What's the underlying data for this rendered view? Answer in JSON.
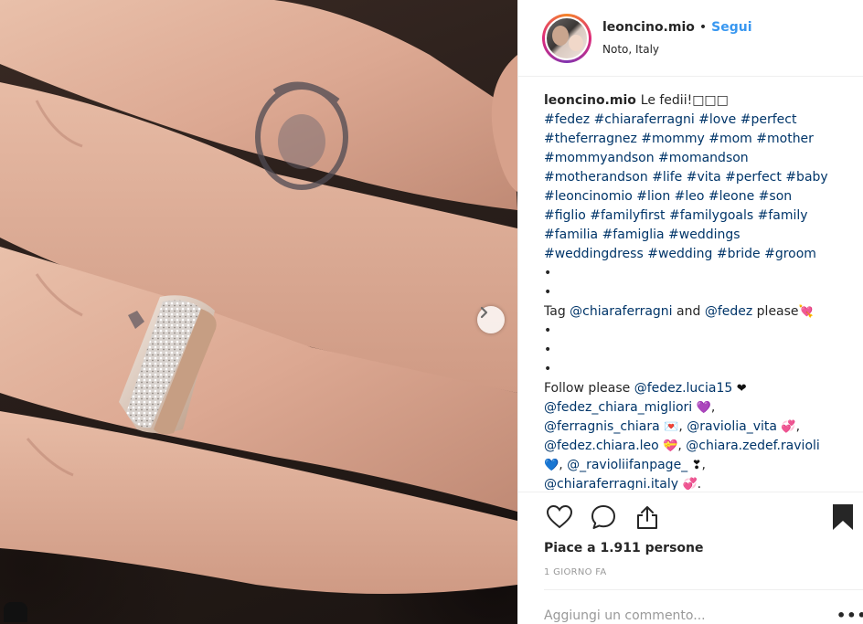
{
  "header": {
    "username": "leoncino.mio",
    "separator": "•",
    "follow_label": "Segui",
    "location": "Noto, Italy"
  },
  "caption": {
    "username": "leoncino.mio",
    "lines": [
      [
        {
          "t": "text",
          "v": "Le fedii!□□□"
        }
      ],
      [
        {
          "t": "tag",
          "v": "#fedez"
        },
        {
          "t": "text",
          "v": " "
        },
        {
          "t": "tag",
          "v": "#chiaraferragni"
        },
        {
          "t": "text",
          "v": " "
        },
        {
          "t": "tag",
          "v": "#love"
        },
        {
          "t": "text",
          "v": " "
        },
        {
          "t": "tag",
          "v": "#perfect"
        }
      ],
      [
        {
          "t": "tag",
          "v": "#theferragnez"
        },
        {
          "t": "text",
          "v": " "
        },
        {
          "t": "tag",
          "v": "#mommy"
        },
        {
          "t": "text",
          "v": " "
        },
        {
          "t": "tag",
          "v": "#mom"
        },
        {
          "t": "text",
          "v": " "
        },
        {
          "t": "tag",
          "v": "#mother"
        }
      ],
      [
        {
          "t": "tag",
          "v": "#mommyandson"
        },
        {
          "t": "text",
          "v": " "
        },
        {
          "t": "tag",
          "v": "#momandson"
        }
      ],
      [
        {
          "t": "tag",
          "v": "#motherandson"
        },
        {
          "t": "text",
          "v": " "
        },
        {
          "t": "tag",
          "v": "#life"
        },
        {
          "t": "text",
          "v": " "
        },
        {
          "t": "tag",
          "v": "#vita"
        },
        {
          "t": "text",
          "v": " "
        },
        {
          "t": "tag",
          "v": "#perfect"
        },
        {
          "t": "text",
          "v": " "
        },
        {
          "t": "tag",
          "v": "#baby"
        }
      ],
      [
        {
          "t": "tag",
          "v": "#leoncinomio"
        },
        {
          "t": "text",
          "v": " "
        },
        {
          "t": "tag",
          "v": "#lion"
        },
        {
          "t": "text",
          "v": " "
        },
        {
          "t": "tag",
          "v": "#leo"
        },
        {
          "t": "text",
          "v": " "
        },
        {
          "t": "tag",
          "v": "#leone"
        },
        {
          "t": "text",
          "v": " "
        },
        {
          "t": "tag",
          "v": "#son"
        }
      ],
      [
        {
          "t": "tag",
          "v": "#figlio"
        },
        {
          "t": "text",
          "v": " "
        },
        {
          "t": "tag",
          "v": "#familyfirst"
        },
        {
          "t": "text",
          "v": " "
        },
        {
          "t": "tag",
          "v": "#familygoals"
        },
        {
          "t": "text",
          "v": " "
        },
        {
          "t": "tag",
          "v": "#family"
        }
      ],
      [
        {
          "t": "tag",
          "v": "#familia"
        },
        {
          "t": "text",
          "v": " "
        },
        {
          "t": "tag",
          "v": "#famiglia"
        },
        {
          "t": "text",
          "v": " "
        },
        {
          "t": "tag",
          "v": "#weddings"
        }
      ],
      [
        {
          "t": "tag",
          "v": "#weddingdress"
        },
        {
          "t": "text",
          "v": " "
        },
        {
          "t": "tag",
          "v": "#wedding"
        },
        {
          "t": "text",
          "v": " "
        },
        {
          "t": "tag",
          "v": "#bride"
        },
        {
          "t": "text",
          "v": " "
        },
        {
          "t": "tag",
          "v": "#groom"
        }
      ],
      [
        {
          "t": "text",
          "v": "•"
        }
      ],
      [
        {
          "t": "text",
          "v": "•"
        }
      ],
      [
        {
          "t": "text",
          "v": "Tag "
        },
        {
          "t": "mention",
          "v": "@chiaraferragni"
        },
        {
          "t": "text",
          "v": " and "
        },
        {
          "t": "mention",
          "v": "@fedez"
        },
        {
          "t": "text",
          "v": " please"
        },
        {
          "t": "emoji",
          "v": "💘",
          "c": "#c0121c"
        }
      ],
      [
        {
          "t": "text",
          "v": "•"
        }
      ],
      [
        {
          "t": "text",
          "v": "•"
        }
      ],
      [
        {
          "t": "text",
          "v": "•"
        }
      ],
      [
        {
          "t": "text",
          "v": "Follow please "
        },
        {
          "t": "mention",
          "v": "@fedez.lucia15"
        },
        {
          "t": "text",
          "v": " "
        },
        {
          "t": "emoji",
          "v": "❤",
          "c": "#111111"
        }
      ],
      [
        {
          "t": "mention",
          "v": "@fedez_chiara_migliori"
        },
        {
          "t": "text",
          "v": " "
        },
        {
          "t": "emoji",
          "v": "💜",
          "c": "#9b30e8"
        },
        {
          "t": "text",
          "v": ","
        }
      ],
      [
        {
          "t": "mention",
          "v": "@ferragnis_chiara"
        },
        {
          "t": "text",
          "v": " "
        },
        {
          "t": "emoji",
          "v": "💌",
          "c": "#e0364b"
        },
        {
          "t": "text",
          "v": ", "
        },
        {
          "t": "mention",
          "v": "@raviolia_vita"
        },
        {
          "t": "text",
          "v": " "
        },
        {
          "t": "emoji",
          "v": "💞",
          "c": "#c0121c"
        },
        {
          "t": "text",
          "v": ","
        }
      ],
      [
        {
          "t": "mention",
          "v": "@fedez.chiara.leo"
        },
        {
          "t": "text",
          "v": " "
        },
        {
          "t": "emoji",
          "v": "💝",
          "c": "#c0121c"
        },
        {
          "t": "text",
          "v": ", "
        },
        {
          "t": "mention",
          "v": "@chiara.zedef.ravioli"
        }
      ],
      [
        {
          "t": "emoji",
          "v": "💙",
          "c": "#1fb5c9"
        },
        {
          "t": "text",
          "v": ", "
        },
        {
          "t": "mention",
          "v": "@_ravioliifanpage_"
        },
        {
          "t": "text",
          "v": " "
        },
        {
          "t": "emoji",
          "v": "❣",
          "c": "#111111"
        },
        {
          "t": "text",
          "v": ","
        }
      ],
      [
        {
          "t": "mention",
          "v": "@chiaraferragni.italy"
        },
        {
          "t": "text",
          "v": " "
        },
        {
          "t": "emoji",
          "v": "💞",
          "c": "#c0121c"
        },
        {
          "t": "text",
          "v": "."
        }
      ]
    ]
  },
  "actions": {
    "like_icon": "heart-outline-icon",
    "comment_icon": "comment-bubble-icon",
    "share_icon": "share-upload-icon",
    "save_icon": "bookmark-filled-icon"
  },
  "likes_text": "Piace a 1.911 persone",
  "time_text": "1 GIORNO FA",
  "comment": {
    "placeholder": "Aggiungi un commento...",
    "more_label": "•••"
  },
  "colors": {
    "accent": "#3897f0",
    "link": "#003569",
    "text": "#262626",
    "muted": "#999999",
    "border": "#efefef"
  }
}
